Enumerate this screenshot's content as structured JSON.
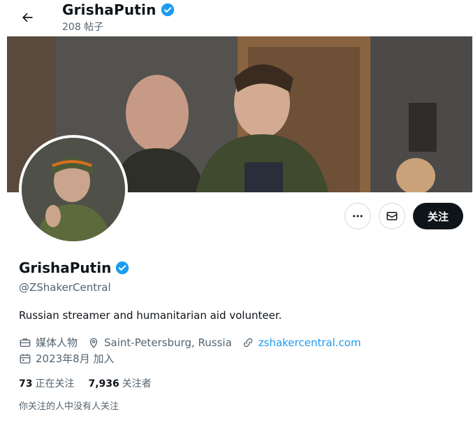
{
  "header": {
    "name": "GrishaPutin",
    "posts_count": "208 帖子"
  },
  "colors": {
    "verified": "#1d9bf0",
    "link": "#1d9bf0",
    "follow_button_bg": "#0f1419"
  },
  "icons": {
    "back": "arrow-left-icon",
    "verified": "verified-badge-icon",
    "more": "ellipsis-icon",
    "message": "envelope-icon",
    "category": "briefcase-icon",
    "location": "location-pin-icon",
    "link": "link-icon",
    "joined": "calendar-icon"
  },
  "actions": {
    "follow_label": "关注"
  },
  "profile": {
    "name": "GrishaPutin",
    "handle": "@ZShakerCentral",
    "bio": "Russian streamer and humanitarian aid volunteer.",
    "category": "媒体人物",
    "location": "Saint-Petersburg, Russia",
    "website": "zshakercentral.com",
    "joined": "2023年8月 加入",
    "following_count": "73",
    "following_label": "正在关注",
    "followers_count": "7,936",
    "followers_label": "关注者",
    "followed_by_note": "你关注的人中没有人关注"
  }
}
